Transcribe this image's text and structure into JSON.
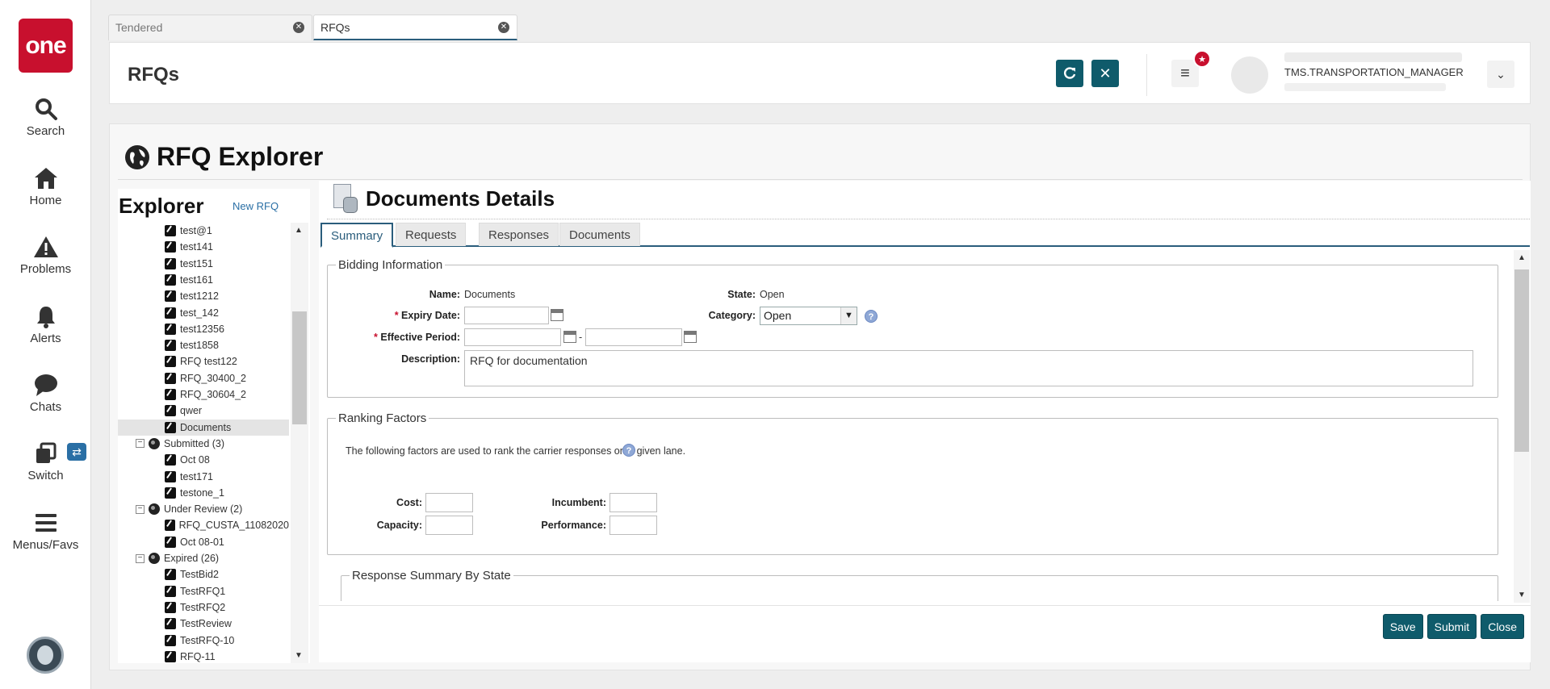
{
  "nav": {
    "logo": "one",
    "items": [
      {
        "label": "Search",
        "icon": "search-icon"
      },
      {
        "label": "Home",
        "icon": "home-icon"
      },
      {
        "label": "Problems",
        "icon": "warning-icon"
      },
      {
        "label": "Alerts",
        "icon": "bell-icon"
      },
      {
        "label": "Chats",
        "icon": "chat-icon"
      },
      {
        "label": "Switch",
        "icon": "switch-icon"
      },
      {
        "label": "Menus/Favs",
        "icon": "menu-icon"
      }
    ]
  },
  "tabs": [
    {
      "label": "Tendered",
      "active": false
    },
    {
      "label": "RFQs",
      "active": true
    }
  ],
  "header": {
    "title": "RFQs",
    "user_role": "TMS.TRANSPORTATION_MANAGER"
  },
  "explorer": {
    "page_title": "RFQ Explorer",
    "panel_title": "Explorer",
    "new_link": "New RFQ",
    "tree": [
      {
        "label": "test@1",
        "type": "doc",
        "level": 2
      },
      {
        "label": "test141",
        "type": "doc",
        "level": 2
      },
      {
        "label": "test151",
        "type": "doc",
        "level": 2
      },
      {
        "label": "test161",
        "type": "doc",
        "level": 2
      },
      {
        "label": "test1212",
        "type": "doc",
        "level": 2
      },
      {
        "label": "test_142",
        "type": "doc",
        "level": 2
      },
      {
        "label": "test12356",
        "type": "doc",
        "level": 2
      },
      {
        "label": "test1858",
        "type": "doc",
        "level": 2
      },
      {
        "label": "RFQ test122",
        "type": "doc",
        "level": 2
      },
      {
        "label": "RFQ_30400_2",
        "type": "doc",
        "level": 2
      },
      {
        "label": "RFQ_30604_2",
        "type": "doc",
        "level": 2
      },
      {
        "label": "qwer",
        "type": "doc",
        "level": 2
      },
      {
        "label": "Documents",
        "type": "doc",
        "level": 2,
        "selected": true
      },
      {
        "label": "Submitted (3)",
        "type": "folder",
        "level": 1
      },
      {
        "label": "Oct 08",
        "type": "doc",
        "level": 2
      },
      {
        "label": "test171",
        "type": "doc",
        "level": 2
      },
      {
        "label": "testone_1",
        "type": "doc",
        "level": 2
      },
      {
        "label": "Under Review (2)",
        "type": "folder",
        "level": 1
      },
      {
        "label": "RFQ_CUSTA_11082020",
        "type": "doc",
        "level": 2
      },
      {
        "label": "Oct 08-01",
        "type": "doc",
        "level": 2
      },
      {
        "label": "Expired (26)",
        "type": "folder",
        "level": 1
      },
      {
        "label": "TestBid2",
        "type": "doc",
        "level": 2
      },
      {
        "label": "TestRFQ1",
        "type": "doc",
        "level": 2
      },
      {
        "label": "TestRFQ2",
        "type": "doc",
        "level": 2
      },
      {
        "label": "TestReview",
        "type": "doc",
        "level": 2
      },
      {
        "label": "TestRFQ-10",
        "type": "doc",
        "level": 2
      },
      {
        "label": "RFQ-11",
        "type": "doc",
        "level": 2
      }
    ]
  },
  "details": {
    "title": "Documents Details",
    "tabs": [
      "Summary",
      "Requests",
      "Responses",
      "Documents"
    ],
    "bidding": {
      "legend": "Bidding Information",
      "name_label": "Name:",
      "name_value": "Documents",
      "state_label": "State:",
      "state_value": "Open",
      "expiry_label": "Expiry Date:",
      "category_label": "Category:",
      "category_value": "Open",
      "effective_label": "Effective Period:",
      "range_sep": "-",
      "description_label": "Description:",
      "description_value": "RFQ for documentation",
      "required_mark": "*"
    },
    "ranking": {
      "legend": "Ranking Factors",
      "note": "The following factors are used to rank the carrier responses on a given lane.",
      "cost_label": "Cost:",
      "capacity_label": "Capacity:",
      "incumbent_label": "Incumbent:",
      "performance_label": "Performance:"
    },
    "response_summary_legend": "Response Summary By State",
    "buttons": {
      "save": "Save",
      "submit": "Submit",
      "close": "Close"
    }
  },
  "colors": {
    "brand": "#c8102e",
    "accent": "#0f5b6b",
    "tab_underline": "#2a5d7c",
    "link": "#2a6fa5"
  }
}
